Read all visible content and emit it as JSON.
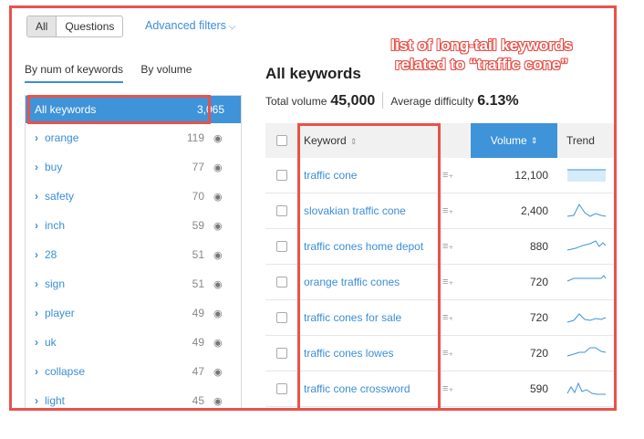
{
  "filters": {
    "tabs": [
      "All",
      "Questions"
    ],
    "advanced_label": "Advanced filters"
  },
  "left_tabs": [
    "By num of keywords",
    "By volume"
  ],
  "left_list": {
    "all": {
      "label": "All keywords",
      "count": "3,065"
    },
    "items": [
      {
        "label": "orange",
        "count": "119"
      },
      {
        "label": "buy",
        "count": "77"
      },
      {
        "label": "safety",
        "count": "70"
      },
      {
        "label": "inch",
        "count": "59"
      },
      {
        "label": "28",
        "count": "51"
      },
      {
        "label": "sign",
        "count": "51"
      },
      {
        "label": "player",
        "count": "49"
      },
      {
        "label": "uk",
        "count": "49"
      },
      {
        "label": "collapse",
        "count": "47"
      },
      {
        "label": "light",
        "count": "45"
      }
    ]
  },
  "main": {
    "title": "All keywords",
    "annotation_line1": "list of long-tail keywords",
    "annotation_line2": "related to “traffic cone”",
    "total_volume_label": "Total volume",
    "total_volume": "45,000",
    "avg_difficulty_label": "Average difficulty",
    "avg_difficulty": "6.13%"
  },
  "table": {
    "headers": {
      "keyword": "Keyword",
      "volume": "Volume",
      "trend": "Trend"
    },
    "rows": [
      {
        "keyword": "traffic cone",
        "volume": "12,100"
      },
      {
        "keyword": "slovakian traffic cone",
        "volume": "2,400"
      },
      {
        "keyword": "traffic cones home depot",
        "volume": "880"
      },
      {
        "keyword": "orange traffic cones",
        "volume": "720"
      },
      {
        "keyword": "traffic cones for sale",
        "volume": "720"
      },
      {
        "keyword": "traffic cones lowes",
        "volume": "720"
      },
      {
        "keyword": "traffic cone crossword",
        "volume": "590"
      }
    ]
  },
  "colors": {
    "accent": "#3f93d9",
    "highlight": "#e8524a"
  }
}
